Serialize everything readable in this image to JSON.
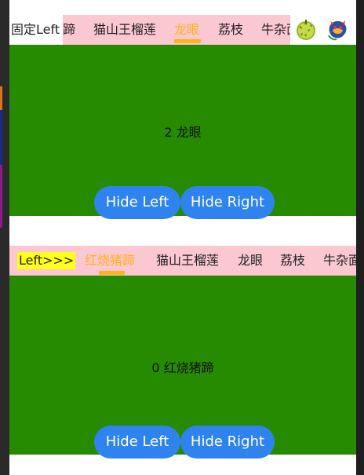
{
  "panel_top": {
    "fixed_left_label": "固定Left",
    "tabs": [
      "蹄",
      "猫山王榴莲",
      "龙眼",
      "荔枝",
      "牛杂面"
    ],
    "active_tab": "龙眼",
    "content_text": "2 龙眼",
    "buttons": {
      "hide_left": "Hide Left",
      "hide_right": "Hide Right"
    },
    "right_icons": [
      "durian-icon",
      "dragon-icon"
    ]
  },
  "panel_bottom": {
    "fixed_left_label": "Left>>>",
    "tabs": [
      "红烧猪蹄",
      "猫山王榴莲",
      "龙眼",
      "荔枝",
      "牛杂面"
    ],
    "active_tab": "红烧猪蹄",
    "content_text": "0 红烧猪蹄",
    "buttons": {
      "hide_left": "Hide Left",
      "hide_right": "Hide Right"
    }
  },
  "colors": {
    "tab_background": "#fbc8d2",
    "active_tab": "#ffb21c",
    "content_background": "#268b00",
    "button": "#2f83ee",
    "fixed_left_highlight": "#ffff1a"
  }
}
